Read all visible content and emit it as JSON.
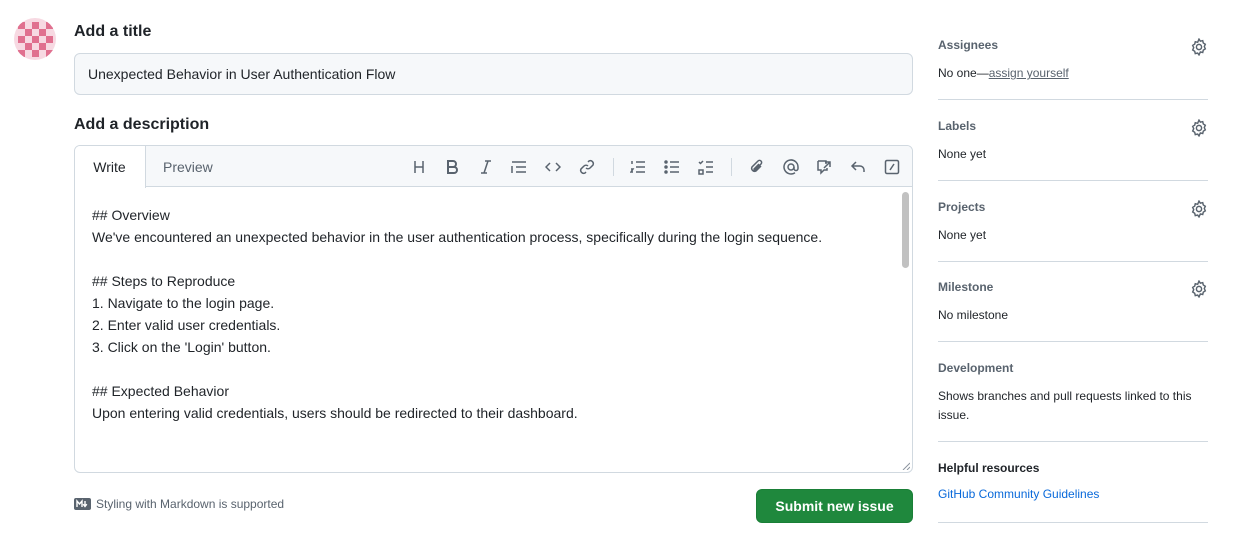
{
  "form": {
    "title_heading": "Add a title",
    "title_value": "Unexpected Behavior in User Authentication Flow",
    "description_heading": "Add a description",
    "tabs": {
      "write": "Write",
      "preview": "Preview"
    },
    "toolbar_icons": [
      "heading-icon",
      "bold-icon",
      "italic-icon",
      "quote-icon",
      "code-icon",
      "link-icon",
      "ordered-list-icon",
      "unordered-list-icon",
      "task-list-icon",
      "attach-icon",
      "mention-icon",
      "reference-icon",
      "reply-icon",
      "slash-command-icon"
    ],
    "body_lines": [
      "## Overview",
      "We've encountered an unexpected behavior in the user authentication process, specifically during the login sequence.",
      "",
      "## Steps to Reproduce",
      "1. Navigate to the login page.",
      "2. Enter valid user credentials.",
      "3. Click on the 'Login' button.",
      "",
      "## Expected Behavior",
      "Upon entering valid credentials, users should be redirected to their dashboard."
    ],
    "markdown_note": "Styling with Markdown is supported",
    "submit_label": "Submit new issue"
  },
  "sidebar": {
    "assignees": {
      "title": "Assignees",
      "value_prefix": "No one—",
      "value_link": "assign yourself"
    },
    "labels": {
      "title": "Labels",
      "value": "None yet"
    },
    "projects": {
      "title": "Projects",
      "value": "None yet"
    },
    "milestone": {
      "title": "Milestone",
      "value": "No milestone"
    },
    "development": {
      "title": "Development",
      "value": "Shows branches and pull requests linked to this issue."
    },
    "helpful": {
      "title": "Helpful resources",
      "link": "GitHub Community Guidelines"
    }
  },
  "colors": {
    "primary_button": "#1f883d",
    "link": "#0969da",
    "avatar_accent": "#e0708f"
  }
}
